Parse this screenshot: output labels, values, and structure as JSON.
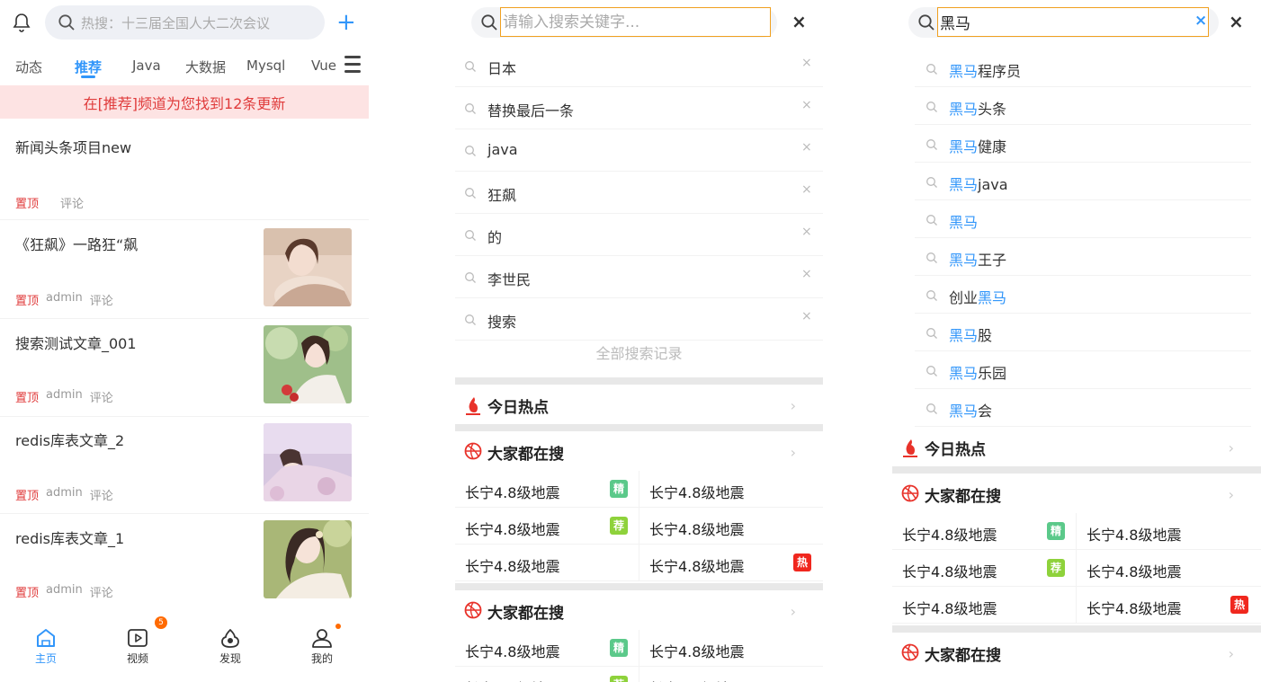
{
  "home": {
    "search_placeholder": "热搜：十三届全国人大二次会议",
    "plus": "+",
    "tabs": [
      "动态",
      "推荐",
      "Java",
      "大数据",
      "Mysql",
      "Vue"
    ],
    "banner": "在[推荐]频道为您找到12条更新",
    "articles": [
      {
        "title": "新闻头条项目new",
        "top": "置顶",
        "author": "",
        "comment": "评论",
        "has_image": false
      },
      {
        "title": "《狂飙》一路狂“飙",
        "top": "置顶",
        "author": "admin",
        "comment": "评论",
        "has_image": true
      },
      {
        "title": "搜索测试文章_001",
        "top": "置顶",
        "author": "admin",
        "comment": "评论",
        "has_image": true
      },
      {
        "title": "redis库表文章_2",
        "top": "置顶",
        "author": "admin",
        "comment": "评论",
        "has_image": true
      },
      {
        "title": "redis库表文章_1",
        "top": "置顶",
        "author": "admin",
        "comment": "评论",
        "has_image": true
      }
    ],
    "nav": [
      {
        "label": "主页",
        "icon": "home-icon"
      },
      {
        "label": "视频",
        "icon": "video-icon",
        "badge": "5"
      },
      {
        "label": "发现",
        "icon": "discover-icon"
      },
      {
        "label": "我的",
        "icon": "user-icon"
      }
    ],
    "accent": "#3296fa",
    "top_color": "#e03c3c"
  },
  "search": {
    "placeholder": "请输入搜索关键字...",
    "close": "×",
    "history": [
      "日本",
      "替换最后一条",
      "java",
      "狂飙",
      "的",
      "李世民",
      "搜索"
    ],
    "history_delete": "×",
    "all_history": "全部搜索记录",
    "today_hot": "今日热点",
    "everyone_search": "大家都在搜",
    "hot_item": "长宁4.8级地震",
    "tags": {
      "jing": "精",
      "jian": "荐",
      "re": "热"
    },
    "tag_colors": {
      "jing": "#5bc98a",
      "jian": "#8ed23b",
      "re": "#f0271e"
    }
  },
  "suggest": {
    "query": "黑马",
    "clear": "×",
    "close": "×",
    "items": [
      {
        "pre": "",
        "hl": "黑马",
        "post": "程序员"
      },
      {
        "pre": "",
        "hl": "黑马",
        "post": "头条"
      },
      {
        "pre": "",
        "hl": "黑马",
        "post": "健康"
      },
      {
        "pre": "",
        "hl": "黑马",
        "post": "java"
      },
      {
        "pre": "",
        "hl": "黑马",
        "post": ""
      },
      {
        "pre": "",
        "hl": "黑马",
        "post": "王子"
      },
      {
        "pre": "创业",
        "hl": "黑马",
        "post": ""
      },
      {
        "pre": "",
        "hl": "黑马",
        "post": "股"
      },
      {
        "pre": "",
        "hl": "黑马",
        "post": "乐园"
      },
      {
        "pre": "",
        "hl": "黑马",
        "post": "会"
      }
    ]
  }
}
